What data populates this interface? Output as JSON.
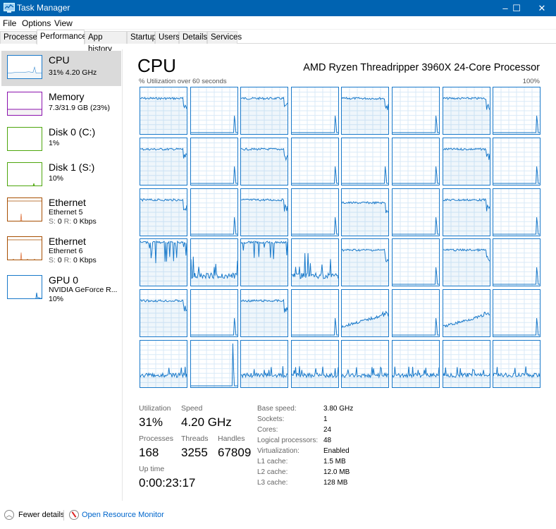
{
  "window": {
    "title": "Task Manager",
    "controls": {
      "minimize": "–",
      "maximize": "☐",
      "close": "✕"
    }
  },
  "menu": [
    "File",
    "Options",
    "View"
  ],
  "tabs": [
    {
      "label": "Processes",
      "active": false
    },
    {
      "label": "Performance",
      "active": true
    },
    {
      "label": "App history",
      "active": false
    },
    {
      "label": "Startup",
      "active": false
    },
    {
      "label": "Users",
      "active": false
    },
    {
      "label": "Details",
      "active": false
    },
    {
      "label": "Services",
      "active": false
    }
  ],
  "sidebar": {
    "items": [
      {
        "name": "CPU",
        "sub1": "31% 4.20 GHz",
        "color": "#1979ca",
        "selected": true
      },
      {
        "name": "Memory",
        "sub1": "7.3/31.9 GB (23%)",
        "color": "#8b12ae",
        "selected": false
      },
      {
        "name": "Disk 0 (C:)",
        "sub1": "1%",
        "color": "#4da60c",
        "selected": false
      },
      {
        "name": "Disk 1 (S:)",
        "sub1": "10%",
        "color": "#4da60c",
        "selected": false
      },
      {
        "name": "Ethernet",
        "sub1": "Ethernet 5",
        "sub2_s": "S:",
        "sub2_sv": "0",
        "sub2_r": "R:",
        "sub2_rv": "0 Kbps",
        "color": "#a74f01",
        "selected": false
      },
      {
        "name": "Ethernet",
        "sub1": "Ethernet 6",
        "sub2_s": "S:",
        "sub2_sv": "0",
        "sub2_r": "R:",
        "sub2_rv": "0 Kbps",
        "color": "#a74f01",
        "selected": false
      },
      {
        "name": "GPU 0",
        "sub1": "NVIDIA GeForce R...",
        "sub2": "10%",
        "color": "#1979ca",
        "selected": false
      }
    ]
  },
  "main": {
    "title": "CPU",
    "processor": "AMD Ryzen Threadripper 3960X 24-Core Processor",
    "axis_left": "% Utilization over 60 seconds",
    "axis_right": "100%",
    "accent": "#1979ca",
    "logical_processor_count": 48
  },
  "stats": {
    "utilization_label": "Utilization",
    "utilization": "31%",
    "speed_label": "Speed",
    "speed": "4.20 GHz",
    "processes_label": "Processes",
    "processes": "168",
    "threads_label": "Threads",
    "threads": "3255",
    "handles_label": "Handles",
    "handles": "67809",
    "uptime_label": "Up time",
    "uptime": "0:00:23:17"
  },
  "details": [
    {
      "label": "Base speed:",
      "value": "3.80 GHz"
    },
    {
      "label": "Sockets:",
      "value": "1"
    },
    {
      "label": "Cores:",
      "value": "24"
    },
    {
      "label": "Logical processors:",
      "value": "48"
    },
    {
      "label": "Virtualization:",
      "value": "Enabled"
    },
    {
      "label": "L1 cache:",
      "value": "1.5 MB"
    },
    {
      "label": "L2 cache:",
      "value": "12.0 MB"
    },
    {
      "label": "L3 cache:",
      "value": "128 MB"
    }
  ],
  "footer": {
    "fewer_details": "Fewer details",
    "open_resource_monitor": "Open Resource Monitor"
  }
}
